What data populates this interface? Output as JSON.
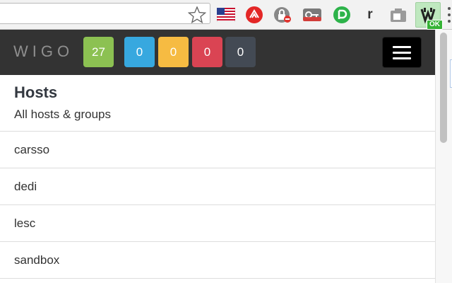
{
  "brand": "WIGO",
  "counters": [
    {
      "id": "ok",
      "value": "27",
      "color": "#8cc152"
    },
    {
      "id": "info",
      "value": "0",
      "color": "#37a8df"
    },
    {
      "id": "warning",
      "value": "0",
      "color": "#f6bb42"
    },
    {
      "id": "critical",
      "value": "0",
      "color": "#da4453"
    },
    {
      "id": "unknown",
      "value": "0",
      "color": "#434a54"
    }
  ],
  "header": {
    "title": "Hosts",
    "subtitle": "All hosts & groups"
  },
  "hosts": [
    "carsso",
    "dedi",
    "lesc",
    "sandbox"
  ],
  "extensions": {
    "r_label": "r",
    "wigo_badge": "OK"
  },
  "icons": {
    "bookmark": "star-icon",
    "menu": "hamburger-icon",
    "more": "vertical-dots-icon"
  }
}
